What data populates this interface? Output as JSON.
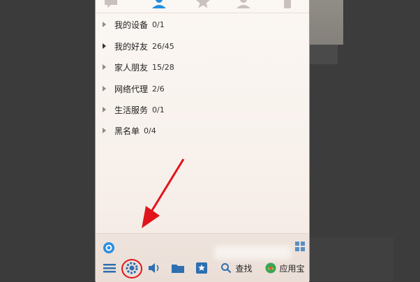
{
  "groups": [
    {
      "name": "我的设备",
      "count": "0/1",
      "expanded": false
    },
    {
      "name": "我的好友",
      "count": "26/45",
      "expanded": false
    },
    {
      "name": "家人朋友",
      "count": "15/28",
      "expanded": false
    },
    {
      "name": "网络代理",
      "count": "2/6",
      "expanded": false
    },
    {
      "name": "生活服务",
      "count": "0/1",
      "expanded": false
    },
    {
      "name": "黑名单",
      "count": "0/4",
      "expanded": false
    }
  ],
  "toolbar": {
    "find_label": "查找",
    "app_label": "应用宝"
  },
  "colors": {
    "accent_tab": "#1e8fe0",
    "annotation_red": "#e0141a"
  },
  "icons": [
    "message-icon",
    "contact-icon",
    "star-icon",
    "group-icon",
    "phone-icon",
    "menu-icon",
    "settings-icon",
    "sound-icon",
    "folder-icon",
    "favorite-icon",
    "search-icon",
    "app-store-icon",
    "browser-icon",
    "grid-icon"
  ]
}
